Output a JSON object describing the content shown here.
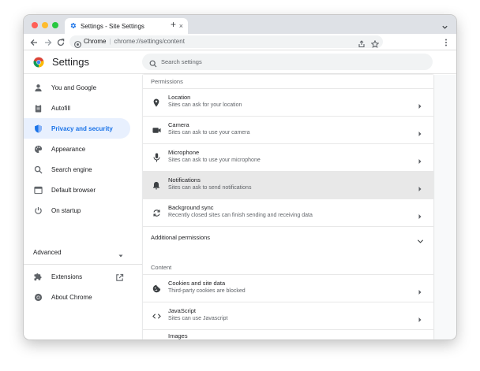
{
  "window": {
    "tab_title": "Settings - Site Settings",
    "tab_close": "×",
    "new_tab": "+",
    "omnibox_site": "Chrome",
    "omnibox_url": "chrome://settings/content"
  },
  "header": {
    "title": "Settings",
    "search_placeholder": "Search settings"
  },
  "sidebar": {
    "items": [
      {
        "label": "You and Google",
        "icon": "person-icon"
      },
      {
        "label": "Autofill",
        "icon": "clipboard-icon"
      },
      {
        "label": "Privacy and security",
        "icon": "shield-icon",
        "active": true
      },
      {
        "label": "Appearance",
        "icon": "palette-icon"
      },
      {
        "label": "Search engine",
        "icon": "search-icon"
      },
      {
        "label": "Default browser",
        "icon": "browser-icon"
      },
      {
        "label": "On startup",
        "icon": "power-icon"
      }
    ],
    "advanced_label": "Advanced",
    "bottom_items": [
      {
        "label": "Extensions",
        "icon": "puzzle-icon"
      },
      {
        "label": "About Chrome",
        "icon": "chrome-icon"
      }
    ]
  },
  "main": {
    "permissions_title": "Permissions",
    "permissions": [
      {
        "title": "Location",
        "subtitle": "Sites can ask for your location",
        "icon": "location-icon"
      },
      {
        "title": "Camera",
        "subtitle": "Sites can ask to use your camera",
        "icon": "camera-icon"
      },
      {
        "title": "Microphone",
        "subtitle": "Sites can ask to use your microphone",
        "icon": "microphone-icon"
      },
      {
        "title": "Notifications",
        "subtitle": "Sites can ask to send notifications",
        "icon": "bell-icon",
        "highlight": true
      },
      {
        "title": "Background sync",
        "subtitle": "Recently closed sites can finish sending and receiving data",
        "icon": "sync-icon"
      }
    ],
    "additional_permissions_label": "Additional permissions",
    "content_title": "Content",
    "content": [
      {
        "title": "Cookies and site data",
        "subtitle": "Third-party cookies are blocked",
        "icon": "cookie-icon"
      },
      {
        "title": "JavaScript",
        "subtitle": "Sites can use Javascript",
        "icon": "code-icon"
      },
      {
        "title": "Images",
        "subtitle": "",
        "icon": "image-icon"
      }
    ]
  },
  "colors": {
    "accent": "#1a73e8",
    "active_nav_bg": "#e8f0fe",
    "highlight_row_bg": "#e8e8e8"
  }
}
